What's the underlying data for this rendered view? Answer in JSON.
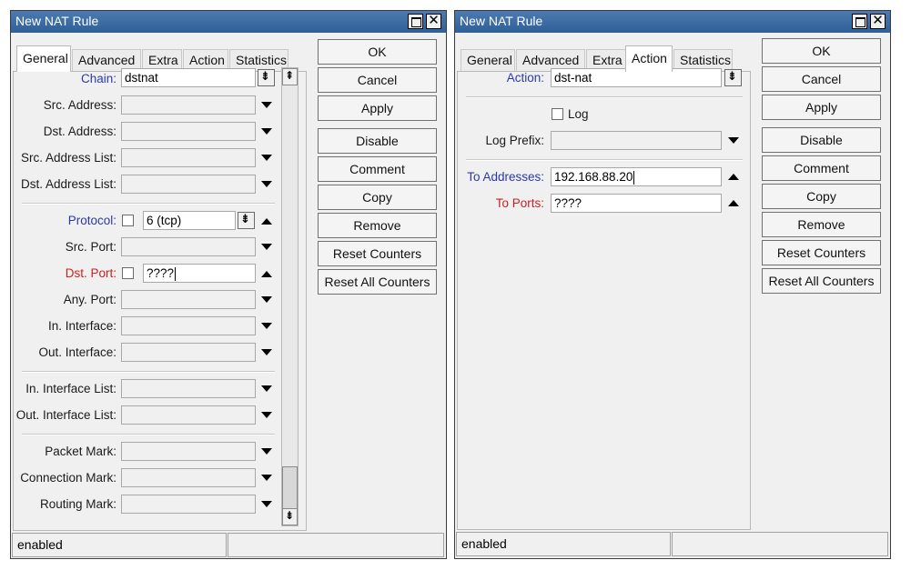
{
  "left_window": {
    "title": "New NAT Rule",
    "tabs": [
      {
        "label": "General",
        "active": true
      },
      {
        "label": "Advanced",
        "active": false
      },
      {
        "label": "Extra",
        "active": false
      },
      {
        "label": "Action",
        "active": false
      },
      {
        "label": "Statistics",
        "active": false
      }
    ],
    "fields": {
      "chain": {
        "label": "Chain:",
        "value": "dstnat"
      },
      "src_address": {
        "label": "Src. Address:",
        "value": ""
      },
      "dst_address": {
        "label": "Dst. Address:",
        "value": ""
      },
      "src_address_list": {
        "label": "Src. Address List:",
        "value": ""
      },
      "dst_address_list": {
        "label": "Dst. Address List:",
        "value": ""
      },
      "protocol": {
        "label": "Protocol:",
        "value": "6 (tcp)"
      },
      "src_port": {
        "label": "Src. Port:",
        "value": ""
      },
      "dst_port": {
        "label": "Dst. Port:",
        "value": "????"
      },
      "any_port": {
        "label": "Any. Port:",
        "value": ""
      },
      "in_interface": {
        "label": "In. Interface:",
        "value": ""
      },
      "out_interface": {
        "label": "Out. Interface:",
        "value": ""
      },
      "in_interface_list": {
        "label": "In. Interface List:",
        "value": ""
      },
      "out_interface_list": {
        "label": "Out. Interface List:",
        "value": ""
      },
      "packet_mark": {
        "label": "Packet Mark:",
        "value": ""
      },
      "connection_mark": {
        "label": "Connection Mark:",
        "value": ""
      },
      "routing_mark": {
        "label": "Routing Mark:",
        "value": ""
      }
    },
    "buttons": [
      "OK",
      "Cancel",
      "Apply",
      "Disable",
      "Comment",
      "Copy",
      "Remove",
      "Reset Counters",
      "Reset All Counters"
    ],
    "status": "enabled"
  },
  "right_window": {
    "title": "New NAT Rule",
    "tabs": [
      {
        "label": "General",
        "active": false
      },
      {
        "label": "Advanced",
        "active": false
      },
      {
        "label": "Extra",
        "active": false
      },
      {
        "label": "Action",
        "active": true
      },
      {
        "label": "Statistics",
        "active": false
      }
    ],
    "fields": {
      "action": {
        "label": "Action:",
        "value": "dst-nat"
      },
      "log": {
        "label": "Log",
        "checked": false
      },
      "log_prefix": {
        "label": "Log Prefix:",
        "value": ""
      },
      "to_addresses": {
        "label": "To Addresses:",
        "value": "192.168.88.20"
      },
      "to_ports": {
        "label": "To Ports:",
        "value": "????"
      }
    },
    "buttons": [
      "OK",
      "Cancel",
      "Apply",
      "Disable",
      "Comment",
      "Copy",
      "Remove",
      "Reset Counters",
      "Reset All Counters"
    ],
    "status": "enabled"
  }
}
